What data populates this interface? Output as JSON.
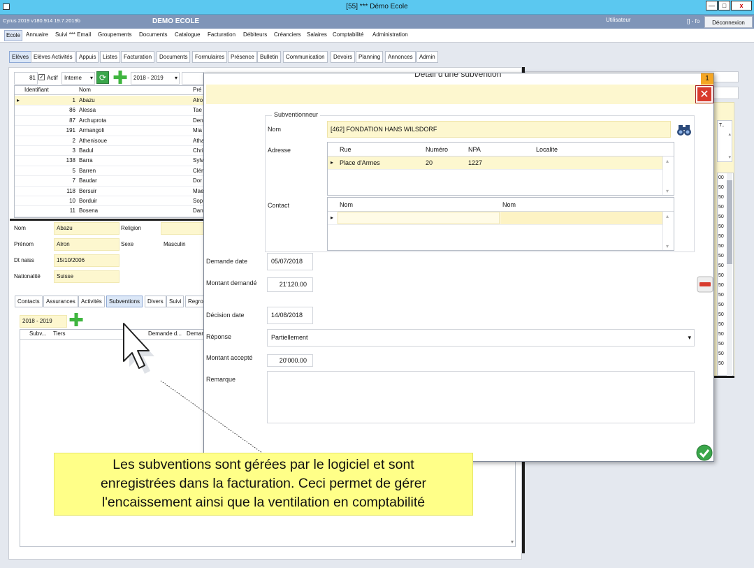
{
  "window": {
    "title": "[55] *** Démo Ecole",
    "minimize": "—",
    "maximize": "□",
    "close": "x"
  },
  "appbar": {
    "version": "Cyrus 2019 v180.914 19.7.2019b",
    "school": "DEMO ECOLE",
    "user_label": "Utilisateur",
    "user_value": "[] - fo",
    "logout": "Déconnexion"
  },
  "menu": [
    "Ecole",
    "Annuaire",
    "Suivi *** Email",
    "Groupements",
    "Documents",
    "Catalogue",
    "Facturation",
    "Débiteurs",
    "Créanciers",
    "Salaires",
    "Comptabilité",
    "Administration"
  ],
  "subtabs": [
    "Elèves",
    "Elèves Activités",
    "Appuis",
    "Listes",
    "Facturation",
    "Documents",
    "Formulaires",
    "Présence",
    "Bulletin",
    "Communication",
    "Devoirs",
    "Planning",
    "Annonces",
    "Admin"
  ],
  "filter": {
    "count": "81",
    "active_label": "Actif",
    "type": "Interne",
    "year": "2018 - 2019"
  },
  "students": {
    "columns": [
      "Identifiant",
      "Nom",
      "Pré"
    ],
    "rows": [
      {
        "id": "1",
        "nom": "Abazu",
        "prenom": "Alro"
      },
      {
        "id": "86",
        "nom": "Alessa",
        "prenom": "Tae"
      },
      {
        "id": "87",
        "nom": "Archuprota",
        "prenom": "Den"
      },
      {
        "id": "191",
        "nom": "Armangoli",
        "prenom": "Mia"
      },
      {
        "id": "2",
        "nom": "Athenisoue",
        "prenom": "Atha"
      },
      {
        "id": "3",
        "nom": "Badul",
        "prenom": "Chri"
      },
      {
        "id": "138",
        "nom": "Barra",
        "prenom": "Sylv"
      },
      {
        "id": "5",
        "nom": "Barren",
        "prenom": "Clén"
      },
      {
        "id": "7",
        "nom": "Baudar",
        "prenom": "Dor"
      },
      {
        "id": "118",
        "nom": "Bersuir",
        "prenom": "Mae"
      },
      {
        "id": "10",
        "nom": "Borduir",
        "prenom": "Sop"
      },
      {
        "id": "11",
        "nom": "Bosena",
        "prenom": "Dan"
      }
    ]
  },
  "student_detail": {
    "nom_label": "Nom",
    "nom": "Abazu",
    "religion_label": "Religion",
    "prenom_label": "Prénom",
    "prenom": "Alron",
    "sexe_label": "Sexe",
    "sexe": "Masculin",
    "dtnaiss_label": "Dt naiss",
    "dtnaiss": "15/10/2006",
    "nationalite_label": "Nationalité",
    "nationalite": "Suisse"
  },
  "detail_tabs": [
    "Contacts",
    "Assurances",
    "Activités",
    "Subventions",
    "Divers",
    "Suivi",
    "Regro"
  ],
  "subventions": {
    "year": "2018 - 2019",
    "columns": [
      "Subv...",
      "Tiers",
      "Demande d...",
      "Deman"
    ]
  },
  "dialog": {
    "title": "Détail d'une subvention",
    "badge": "1",
    "group_label": "Subventionneur",
    "nom_label": "Nom",
    "nom_value": "[462] FONDATION HANS WILSDORF",
    "adresse_label": "Adresse",
    "address_columns": [
      "Rue",
      "Numéro",
      "NPA",
      "Localite"
    ],
    "address_row": {
      "rue": "Place d'Armes",
      "numero": "20",
      "npa": "1227",
      "localite": ""
    },
    "contact_label": "Contact",
    "contact_columns": [
      "Nom",
      "Nom"
    ],
    "demande_date_label": "Demande date",
    "demande_date": "05/07/2018",
    "montant_demande_label": "Montant demandé",
    "montant_demande": "21'120.00",
    "decision_date_label": "Décision date",
    "decision_date": "14/08/2018",
    "reponse_label": "Réponse",
    "reponse": "Partiellement",
    "montant_accepte_label": "Montant accepté",
    "montant_accepte": "20'000.00",
    "remarque_label": "Remarque",
    "remarque": ""
  },
  "right_codes": [
    "00",
    "50",
    "50",
    "50",
    "50",
    "50",
    "50",
    "50",
    "50",
    "50",
    "50",
    "50",
    "50",
    "50",
    "50",
    "50",
    "50",
    "50",
    "50",
    "50"
  ],
  "callout": {
    "line1": "Les subventions sont gérées par le logiciel et sont",
    "line2": "enregistrées dans la facturation. Ceci permet de gérer",
    "line3": "l'encaissement ainsi que la ventilation en comptabilité"
  }
}
